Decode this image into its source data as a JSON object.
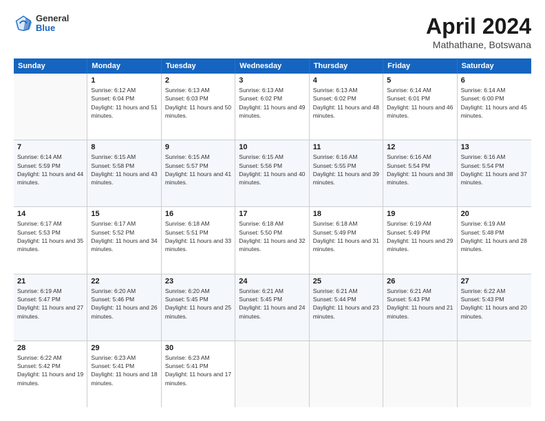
{
  "header": {
    "logo": {
      "general": "General",
      "blue": "Blue"
    },
    "title": "April 2024",
    "location": "Mathathane, Botswana"
  },
  "weekdays": [
    "Sunday",
    "Monday",
    "Tuesday",
    "Wednesday",
    "Thursday",
    "Friday",
    "Saturday"
  ],
  "weeks": [
    [
      {
        "day": "",
        "sunrise": "",
        "sunset": "",
        "daylight": ""
      },
      {
        "day": "1",
        "sunrise": "Sunrise: 6:12 AM",
        "sunset": "Sunset: 6:04 PM",
        "daylight": "Daylight: 11 hours and 51 minutes."
      },
      {
        "day": "2",
        "sunrise": "Sunrise: 6:13 AM",
        "sunset": "Sunset: 6:03 PM",
        "daylight": "Daylight: 11 hours and 50 minutes."
      },
      {
        "day": "3",
        "sunrise": "Sunrise: 6:13 AM",
        "sunset": "Sunset: 6:02 PM",
        "daylight": "Daylight: 11 hours and 49 minutes."
      },
      {
        "day": "4",
        "sunrise": "Sunrise: 6:13 AM",
        "sunset": "Sunset: 6:02 PM",
        "daylight": "Daylight: 11 hours and 48 minutes."
      },
      {
        "day": "5",
        "sunrise": "Sunrise: 6:14 AM",
        "sunset": "Sunset: 6:01 PM",
        "daylight": "Daylight: 11 hours and 46 minutes."
      },
      {
        "day": "6",
        "sunrise": "Sunrise: 6:14 AM",
        "sunset": "Sunset: 6:00 PM",
        "daylight": "Daylight: 11 hours and 45 minutes."
      }
    ],
    [
      {
        "day": "7",
        "sunrise": "Sunrise: 6:14 AM",
        "sunset": "Sunset: 5:59 PM",
        "daylight": "Daylight: 11 hours and 44 minutes."
      },
      {
        "day": "8",
        "sunrise": "Sunrise: 6:15 AM",
        "sunset": "Sunset: 5:58 PM",
        "daylight": "Daylight: 11 hours and 43 minutes."
      },
      {
        "day": "9",
        "sunrise": "Sunrise: 6:15 AM",
        "sunset": "Sunset: 5:57 PM",
        "daylight": "Daylight: 11 hours and 41 minutes."
      },
      {
        "day": "10",
        "sunrise": "Sunrise: 6:15 AM",
        "sunset": "Sunset: 5:56 PM",
        "daylight": "Daylight: 11 hours and 40 minutes."
      },
      {
        "day": "11",
        "sunrise": "Sunrise: 6:16 AM",
        "sunset": "Sunset: 5:55 PM",
        "daylight": "Daylight: 11 hours and 39 minutes."
      },
      {
        "day": "12",
        "sunrise": "Sunrise: 6:16 AM",
        "sunset": "Sunset: 5:54 PM",
        "daylight": "Daylight: 11 hours and 38 minutes."
      },
      {
        "day": "13",
        "sunrise": "Sunrise: 6:16 AM",
        "sunset": "Sunset: 5:54 PM",
        "daylight": "Daylight: 11 hours and 37 minutes."
      }
    ],
    [
      {
        "day": "14",
        "sunrise": "Sunrise: 6:17 AM",
        "sunset": "Sunset: 5:53 PM",
        "daylight": "Daylight: 11 hours and 35 minutes."
      },
      {
        "day": "15",
        "sunrise": "Sunrise: 6:17 AM",
        "sunset": "Sunset: 5:52 PM",
        "daylight": "Daylight: 11 hours and 34 minutes."
      },
      {
        "day": "16",
        "sunrise": "Sunrise: 6:18 AM",
        "sunset": "Sunset: 5:51 PM",
        "daylight": "Daylight: 11 hours and 33 minutes."
      },
      {
        "day": "17",
        "sunrise": "Sunrise: 6:18 AM",
        "sunset": "Sunset: 5:50 PM",
        "daylight": "Daylight: 11 hours and 32 minutes."
      },
      {
        "day": "18",
        "sunrise": "Sunrise: 6:18 AM",
        "sunset": "Sunset: 5:49 PM",
        "daylight": "Daylight: 11 hours and 31 minutes."
      },
      {
        "day": "19",
        "sunrise": "Sunrise: 6:19 AM",
        "sunset": "Sunset: 5:49 PM",
        "daylight": "Daylight: 11 hours and 29 minutes."
      },
      {
        "day": "20",
        "sunrise": "Sunrise: 6:19 AM",
        "sunset": "Sunset: 5:48 PM",
        "daylight": "Daylight: 11 hours and 28 minutes."
      }
    ],
    [
      {
        "day": "21",
        "sunrise": "Sunrise: 6:19 AM",
        "sunset": "Sunset: 5:47 PM",
        "daylight": "Daylight: 11 hours and 27 minutes."
      },
      {
        "day": "22",
        "sunrise": "Sunrise: 6:20 AM",
        "sunset": "Sunset: 5:46 PM",
        "daylight": "Daylight: 11 hours and 26 minutes."
      },
      {
        "day": "23",
        "sunrise": "Sunrise: 6:20 AM",
        "sunset": "Sunset: 5:45 PM",
        "daylight": "Daylight: 11 hours and 25 minutes."
      },
      {
        "day": "24",
        "sunrise": "Sunrise: 6:21 AM",
        "sunset": "Sunset: 5:45 PM",
        "daylight": "Daylight: 11 hours and 24 minutes."
      },
      {
        "day": "25",
        "sunrise": "Sunrise: 6:21 AM",
        "sunset": "Sunset: 5:44 PM",
        "daylight": "Daylight: 11 hours and 23 minutes."
      },
      {
        "day": "26",
        "sunrise": "Sunrise: 6:21 AM",
        "sunset": "Sunset: 5:43 PM",
        "daylight": "Daylight: 11 hours and 21 minutes."
      },
      {
        "day": "27",
        "sunrise": "Sunrise: 6:22 AM",
        "sunset": "Sunset: 5:43 PM",
        "daylight": "Daylight: 11 hours and 20 minutes."
      }
    ],
    [
      {
        "day": "28",
        "sunrise": "Sunrise: 6:22 AM",
        "sunset": "Sunset: 5:42 PM",
        "daylight": "Daylight: 11 hours and 19 minutes."
      },
      {
        "day": "29",
        "sunrise": "Sunrise: 6:23 AM",
        "sunset": "Sunset: 5:41 PM",
        "daylight": "Daylight: 11 hours and 18 minutes."
      },
      {
        "day": "30",
        "sunrise": "Sunrise: 6:23 AM",
        "sunset": "Sunset: 5:41 PM",
        "daylight": "Daylight: 11 hours and 17 minutes."
      },
      {
        "day": "",
        "sunrise": "",
        "sunset": "",
        "daylight": ""
      },
      {
        "day": "",
        "sunrise": "",
        "sunset": "",
        "daylight": ""
      },
      {
        "day": "",
        "sunrise": "",
        "sunset": "",
        "daylight": ""
      },
      {
        "day": "",
        "sunrise": "",
        "sunset": "",
        "daylight": ""
      }
    ]
  ]
}
